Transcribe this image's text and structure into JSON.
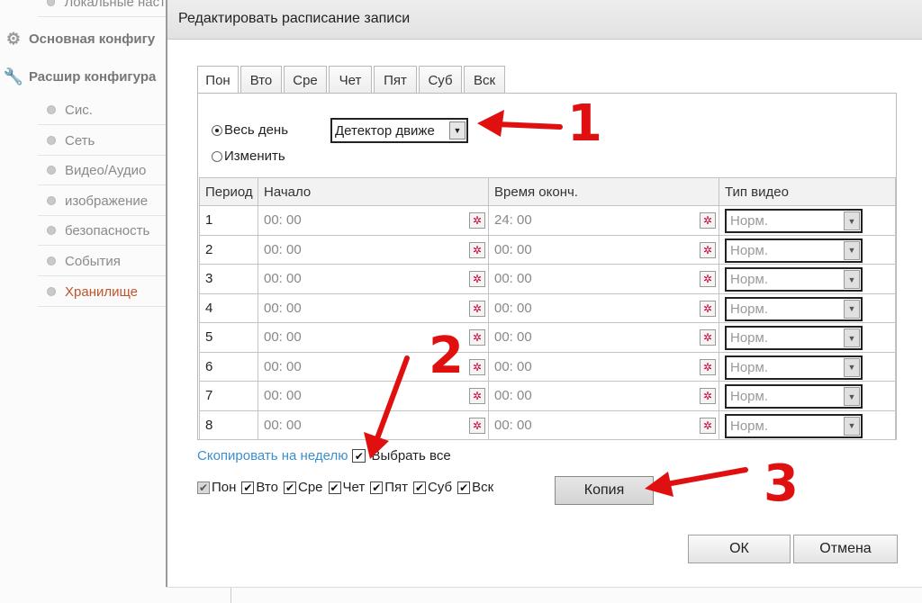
{
  "sidebar": {
    "groups": [
      {
        "label": "Основная конфигу",
        "icon": "gear-icon"
      },
      {
        "label": "Расшир конфигура",
        "icon": "wrench-icon"
      }
    ],
    "top_item": "Локальные наст",
    "items": [
      {
        "label": "Сис."
      },
      {
        "label": "Сеть"
      },
      {
        "label": "Видео/Аудио"
      },
      {
        "label": "изображение"
      },
      {
        "label": "безопасность"
      },
      {
        "label": "События"
      },
      {
        "label": "Хранилище",
        "active": true
      }
    ]
  },
  "dialog": {
    "title": "Редактировать расписание записи",
    "tabs": [
      {
        "label": "Пон",
        "active": true
      },
      {
        "label": "Вто"
      },
      {
        "label": "Сре"
      },
      {
        "label": "Чет"
      },
      {
        "label": "Пят"
      },
      {
        "label": "Суб"
      },
      {
        "label": "Вск"
      }
    ],
    "mode": {
      "all_day_label": "Весь день",
      "edit_label": "Изменить",
      "selected": "all_day",
      "record_type_value": "Детектор движе"
    },
    "table": {
      "headers": [
        "Период",
        "Начало",
        "Время оконч.",
        "Тип видео"
      ],
      "rows": [
        {
          "period": "1",
          "start": "00: 00",
          "end": "24: 00",
          "type": "Норм."
        },
        {
          "period": "2",
          "start": "00: 00",
          "end": "00: 00",
          "type": "Норм."
        },
        {
          "period": "3",
          "start": "00: 00",
          "end": "00: 00",
          "type": "Норм."
        },
        {
          "period": "4",
          "start": "00: 00",
          "end": "00: 00",
          "type": "Норм."
        },
        {
          "period": "5",
          "start": "00: 00",
          "end": "00: 00",
          "type": "Норм."
        },
        {
          "period": "6",
          "start": "00: 00",
          "end": "00: 00",
          "type": "Норм."
        },
        {
          "period": "7",
          "start": "00: 00",
          "end": "00: 00",
          "type": "Норм."
        },
        {
          "period": "8",
          "start": "00: 00",
          "end": "00: 00",
          "type": "Норм."
        }
      ]
    },
    "copy": {
      "link_label": "Скопировать на неделю",
      "select_all_label": "Выбрать все",
      "select_all_checked": true,
      "days": [
        {
          "label": "Пон",
          "checked": true,
          "disabled": true
        },
        {
          "label": "Вто",
          "checked": true
        },
        {
          "label": "Сре",
          "checked": true
        },
        {
          "label": "Чет",
          "checked": true
        },
        {
          "label": "Пят",
          "checked": true
        },
        {
          "label": "Суб",
          "checked": true
        },
        {
          "label": "Вск",
          "checked": true
        }
      ],
      "copy_button": "Копия"
    },
    "ok_button": "ОК",
    "cancel_button": "Отмена"
  },
  "annotations": {
    "numbers": [
      "1",
      "2",
      "3"
    ],
    "color": "#e01010"
  }
}
